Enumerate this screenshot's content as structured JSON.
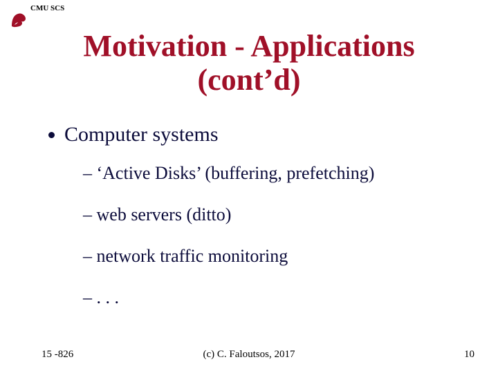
{
  "header": {
    "label": "CMU SCS"
  },
  "title_line1": "Motivation - Applications",
  "title_line2": "(cont’d)",
  "bullet": "Computer systems",
  "sub_items": [
    "– ‘Active Disks’ (buffering, prefetching)",
    "– web servers (ditto)",
    "– network traffic monitoring",
    "– . . ."
  ],
  "footer": {
    "course": "15 -826",
    "copyright": "(c) C. Faloutsos, 2017",
    "page": "10"
  }
}
